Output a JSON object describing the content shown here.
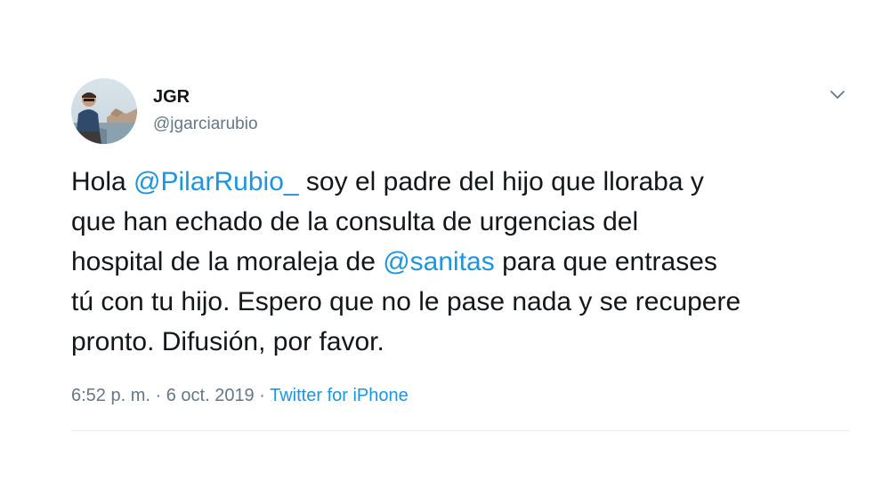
{
  "author": {
    "display_name": "JGR",
    "handle": "@jgarciarubio",
    "avatar_icon": "profile-photo"
  },
  "more_icon": "chevron-down-icon",
  "tweet": {
    "lines": [
      [
        {
          "text": "Hola ",
          "type": "text"
        },
        {
          "text": "@PilarRubio_",
          "type": "mention"
        },
        {
          "text": " soy el padre del hijo que lloraba y",
          "type": "text"
        }
      ],
      [
        {
          "text": "que han echado de la consulta de urgencias del",
          "type": "text"
        }
      ],
      [
        {
          "text": "hospital de la moraleja de ",
          "type": "text"
        },
        {
          "text": "@sanitas",
          "type": "mention"
        },
        {
          "text": " para que entrases",
          "type": "text"
        }
      ],
      [
        {
          "text": "tú con tu hijo. Espero que no le pase nada y se recupere",
          "type": "text"
        }
      ],
      [
        {
          "text": "pronto. Difusión, por favor.",
          "type": "text"
        }
      ]
    ]
  },
  "meta": {
    "time": "6:52 p. m.",
    "separator": " · ",
    "date": "6 oct. 2019",
    "source": "Twitter for iPhone"
  },
  "colors": {
    "link": "#1b95e0",
    "secondary_text": "#657786",
    "primary_text": "#14171a",
    "divider": "#e6ecf0"
  }
}
